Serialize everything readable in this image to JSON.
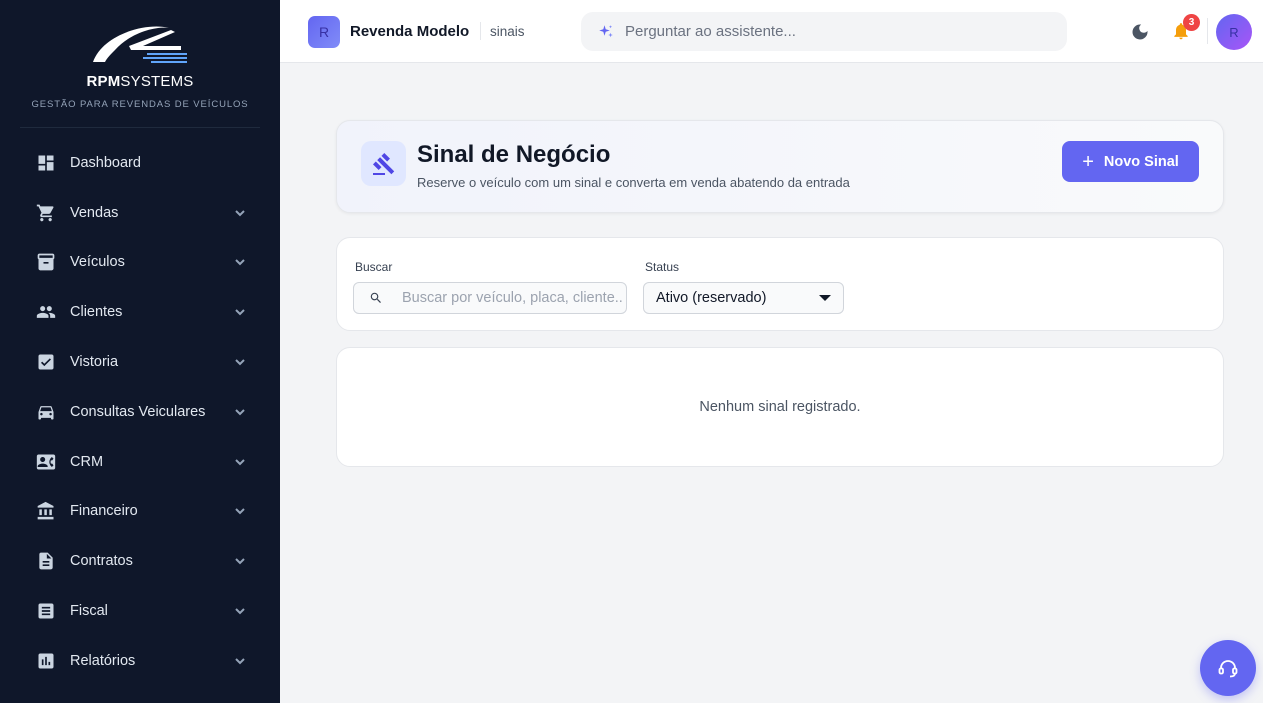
{
  "sidebar": {
    "brand": {
      "bold": "RPM",
      "rest": "SYSTEMS",
      "tagline": "GESTÃO PARA REVENDAS DE VEÍCULOS"
    },
    "items": [
      {
        "label": "Dashboard",
        "icon": "dashboard-icon"
      },
      {
        "label": "Vendas",
        "icon": "cart-icon"
      },
      {
        "label": "Veículos",
        "icon": "archive-icon"
      },
      {
        "label": "Clientes",
        "icon": "people-icon"
      },
      {
        "label": "Vistoria",
        "icon": "checklist-icon"
      },
      {
        "label": "Consultas Veiculares",
        "icon": "car-icon"
      },
      {
        "label": "CRM",
        "icon": "contact-card-icon"
      },
      {
        "label": "Financeiro",
        "icon": "bank-icon"
      },
      {
        "label": "Contratos",
        "icon": "document-icon"
      },
      {
        "label": "Fiscal",
        "icon": "receipt-icon"
      },
      {
        "label": "Relatórios",
        "icon": "bar-chart-icon"
      }
    ]
  },
  "topbar": {
    "store_initial": "R",
    "store_name": "Revenda Modelo",
    "breadcrumb": "sinais",
    "assistant_placeholder": "Perguntar ao assistente...",
    "notification_count": "3",
    "user_initial": "R"
  },
  "header": {
    "title": "Sinal de Negócio",
    "subtitle": "Reserve o veículo com um sinal e converta em venda abatendo da entrada",
    "new_button_label": "Novo Sinal"
  },
  "filters": {
    "search_label": "Buscar",
    "search_placeholder": "Buscar por veículo, placa, cliente...",
    "status_label": "Status",
    "status_value": "Ativo (reservado)"
  },
  "empty": {
    "message": "Nenhum sinal registrado."
  },
  "colors": {
    "sidebar_bg": "#0f172a",
    "accent": "#6366f1",
    "badge": "#ef4444"
  }
}
